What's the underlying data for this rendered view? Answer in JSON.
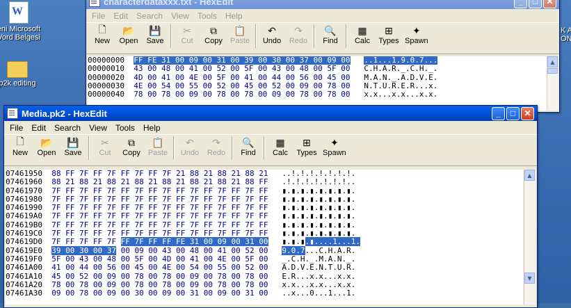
{
  "desktop": {
    "icons": [
      {
        "label_line1": "eni Microsoft",
        "label_line2": "Vord Belgesi",
        "icon": "word-document-icon"
      },
      {
        "label_line1": "p2k editing",
        "label_line2": "",
        "icon": "folder-icon"
      }
    ],
    "right_edge_text": "K A\nON"
  },
  "back_window": {
    "title": "characterdataxxx.txt - HexEdit",
    "menu": [
      "File",
      "Edit",
      "Search",
      "View",
      "Tools",
      "Help"
    ],
    "toolbar": [
      {
        "label": "New",
        "icon": "new-file-icon",
        "enabled": true
      },
      {
        "label": "Open",
        "icon": "open-folder-icon",
        "enabled": true
      },
      {
        "label": "Save",
        "icon": "save-disk-icon",
        "enabled": true
      },
      {
        "label": "Cut",
        "icon": "scissors-icon",
        "enabled": false
      },
      {
        "label": "Copy",
        "icon": "copy-icon",
        "enabled": true
      },
      {
        "label": "Paste",
        "icon": "paste-icon",
        "enabled": false
      },
      {
        "label": "Undo",
        "icon": "undo-icon",
        "enabled": true
      },
      {
        "label": "Redo",
        "icon": "redo-icon",
        "enabled": false
      },
      {
        "label": "Find",
        "icon": "magnifier-icon",
        "enabled": true
      },
      {
        "label": "Calc",
        "icon": "calculator-icon",
        "enabled": true
      },
      {
        "label": "Types",
        "icon": "types-icon",
        "enabled": true
      },
      {
        "label": "Spawn",
        "icon": "spawn-icon",
        "enabled": true
      }
    ],
    "rows": [
      {
        "addr": "00000000",
        "bytes_sel": "FF FE 31 00 09 00 31 00 39 00 30 00 37 00 09 00",
        "bytes": "",
        "ascii_sel": "..1...1.9.0.7...",
        "ascii": ""
      },
      {
        "addr": "00000010",
        "bytes_sel": "",
        "bytes": "43 00 48 00 41 00 52 00 5F 00 43 00 48 00 5F 00",
        "ascii_sel": "",
        "ascii": "C.H.A.R._.C.H._."
      },
      {
        "addr": "00000020",
        "bytes_sel": "",
        "bytes": "4D 00 41 00 4E 00 5F 00 41 00 44 00 56 00 45 00",
        "ascii_sel": "",
        "ascii": "M.A.N._.A.D.V.E."
      },
      {
        "addr": "00000030",
        "bytes_sel": "",
        "bytes": "4E 00 54 00 55 00 52 00 45 00 52 00 09 00 78 00",
        "ascii_sel": "",
        "ascii": "N.T.U.R.E.R...x."
      },
      {
        "addr": "00000040",
        "bytes_sel": "",
        "bytes": "78 00 78 00 09 00 78 00 78 00 09 00 78 00 78 00",
        "ascii_sel": "",
        "ascii": "x.x...x.x...x.x."
      }
    ]
  },
  "front_window": {
    "title": "Media.pk2 - HexEdit",
    "menu": [
      "File",
      "Edit",
      "Search",
      "View",
      "Tools",
      "Help"
    ],
    "toolbar": [
      {
        "label": "New",
        "icon": "new-file-icon",
        "enabled": true
      },
      {
        "label": "Open",
        "icon": "open-folder-icon",
        "enabled": true
      },
      {
        "label": "Save",
        "icon": "save-disk-icon",
        "enabled": true
      },
      {
        "label": "Cut",
        "icon": "scissors-icon",
        "enabled": false
      },
      {
        "label": "Copy",
        "icon": "copy-icon",
        "enabled": true
      },
      {
        "label": "Paste",
        "icon": "paste-icon",
        "enabled": false
      },
      {
        "label": "Undo",
        "icon": "undo-icon",
        "enabled": false
      },
      {
        "label": "Redo",
        "icon": "redo-icon",
        "enabled": false
      },
      {
        "label": "Find",
        "icon": "magnifier-icon",
        "enabled": true
      },
      {
        "label": "Calc",
        "icon": "calculator-icon",
        "enabled": true
      },
      {
        "label": "Types",
        "icon": "types-icon",
        "enabled": true
      },
      {
        "label": "Spawn",
        "icon": "spawn-icon",
        "enabled": true
      }
    ],
    "rows": [
      {
        "addr": "07461950",
        "bytes_pre": "88 FF 7F FF 7F FF 7F FF 7F 21 88 21 88 21 88 21",
        "bytes_sel": "",
        "bytes_post": "",
        "ascii_pre": "..!.!.!.!.!.!.!.",
        "ascii_sel": "",
        "ascii_post": ""
      },
      {
        "addr": "07461960",
        "bytes_pre": "88 21 88 21 88 21 88 21 88 21 88 21 88 21 88 FF",
        "bytes_sel": "",
        "bytes_post": "",
        "ascii_pre": ".!.!.!.!.!.!.!..",
        "ascii_sel": "",
        "ascii_post": ""
      },
      {
        "addr": "07461970",
        "bytes_pre": "7F FF 7F FF 7F FF 7F FF 7F FF 7F FF 7F FF 7F FF",
        "bytes_sel": "",
        "bytes_post": "",
        "ascii_pre": "▮.▮.▮.▮.▮.▮.▮.▮.",
        "ascii_sel": "",
        "ascii_post": ""
      },
      {
        "addr": "07461980",
        "bytes_pre": "7F FF 7F FF 7F FF 7F FF 7F FF 7F FF 7F FF 7F FF",
        "bytes_sel": "",
        "bytes_post": "",
        "ascii_pre": "▮.▮.▮.▮.▮.▮.▮.▮.",
        "ascii_sel": "",
        "ascii_post": ""
      },
      {
        "addr": "07461990",
        "bytes_pre": "7F FF 7F FF 7F FF 7F FF 7F FF 7F FF 7F FF 7F FF",
        "bytes_sel": "",
        "bytes_post": "",
        "ascii_pre": "▮.▮.▮.▮.▮.▮.▮.▮.",
        "ascii_sel": "",
        "ascii_post": ""
      },
      {
        "addr": "074619A0",
        "bytes_pre": "7F FF 7F FF 7F FF 7F FF 7F FF 7F FF 7F FF 7F FF",
        "bytes_sel": "",
        "bytes_post": "",
        "ascii_pre": "▮.▮.▮.▮.▮.▮.▮.▮.",
        "ascii_sel": "",
        "ascii_post": ""
      },
      {
        "addr": "074619B0",
        "bytes_pre": "7F FF 7F FF 7F FF 7F FF 7F FF 7F FF 7F FF 7F FF",
        "bytes_sel": "",
        "bytes_post": "",
        "ascii_pre": "▮.▮.▮.▮.▮.▮.▮.▮.",
        "ascii_sel": "",
        "ascii_post": ""
      },
      {
        "addr": "074619C0",
        "bytes_pre": "7F FF 7F FF 7F FF 7F FF 7F FF 7F FF 7F FF 7F FF",
        "bytes_sel": "",
        "bytes_post": "",
        "ascii_pre": "▮.▮.▮.▮.▮.▮.▮.▮.",
        "ascii_sel": "",
        "ascii_post": ""
      },
      {
        "addr": "074619D0",
        "bytes_pre": "7F FF 7F FF 7F ",
        "bytes_sel": "FF 7F FF FF FE 31 00 09 00 31 00",
        "bytes_post": "",
        "ascii_pre": "▮.▮.▮",
        "ascii_sel": ".▮....1...1.",
        "ascii_post": ""
      },
      {
        "addr": "074619E0",
        "bytes_pre": "",
        "bytes_sel": "39 00 30 00 37",
        "bytes_post": " 00 09 00 43 00 48 00 41 00 52 00",
        "ascii_pre": "",
        "ascii_sel": "9.0.7",
        "ascii_post": "...C.H.A.R."
      },
      {
        "addr": "074619F0",
        "bytes_pre": "5F 00 43 00 48 00 5F 00 4D 00 41 00 4E 00 5F 00",
        "bytes_sel": "",
        "bytes_post": "",
        "ascii_pre": "_.C.H._.M.A.N._.",
        "ascii_sel": "",
        "ascii_post": ""
      },
      {
        "addr": "07461A00",
        "bytes_pre": "41 00 44 00 56 00 45 00 4E 00 54 00 55 00 52 00",
        "bytes_sel": "",
        "bytes_post": "",
        "ascii_pre": "A.D.V.E.N.T.U.R.",
        "ascii_sel": "",
        "ascii_post": ""
      },
      {
        "addr": "07461A10",
        "bytes_pre": "45 00 52 00 09 00 78 00 78 00 09 00 78 00 78 00",
        "bytes_sel": "",
        "bytes_post": "",
        "ascii_pre": "E.R...x.x...x.x.",
        "ascii_sel": "",
        "ascii_post": ""
      },
      {
        "addr": "07461A20",
        "bytes_pre": "78 00 78 00 09 00 78 00 78 00 09 00 78 00 78 00",
        "bytes_sel": "",
        "bytes_post": "",
        "ascii_pre": "x.x...x.x...x.x.",
        "ascii_sel": "",
        "ascii_post": ""
      },
      {
        "addr": "07461A30",
        "bytes_pre": "09 00 78 00 09 00 30 00 09 00 31 00 09 00 31 00",
        "bytes_sel": "",
        "bytes_post": "",
        "ascii_pre": "..x...0...1...1.",
        "ascii_sel": "",
        "ascii_post": ""
      }
    ]
  }
}
